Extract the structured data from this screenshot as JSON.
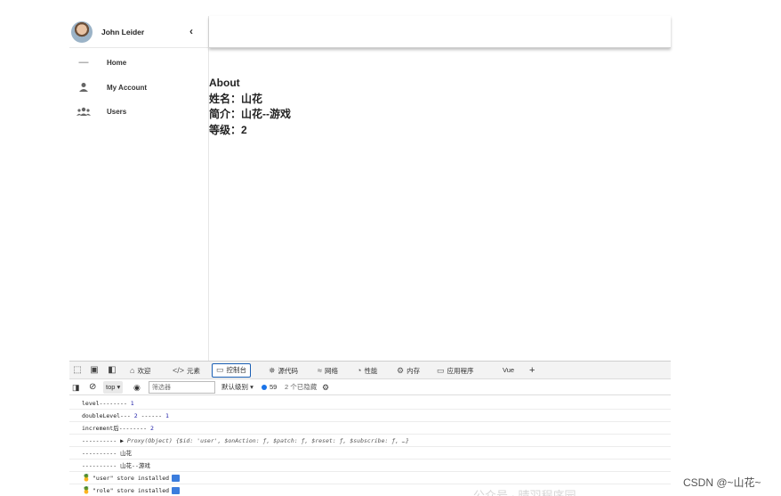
{
  "sidebar": {
    "user_name": "John Leider",
    "items": [
      {
        "label": "Home",
        "icon": "minus-icon"
      },
      {
        "label": "My Account",
        "icon": "person-icon"
      },
      {
        "label": "Users",
        "icon": "group-icon"
      }
    ]
  },
  "main": {
    "heading": "About",
    "lines": [
      "姓名：山花",
      "简介：山花--游戏",
      "等级：2"
    ]
  },
  "devtools": {
    "tabs": [
      {
        "label": "欢迎",
        "icon": "home-icon"
      },
      {
        "label": "元素",
        "icon": "code-icon"
      },
      {
        "label": "控制台",
        "icon": "console-icon"
      },
      {
        "label": "源代码",
        "icon": "bug-icon"
      },
      {
        "label": "网络",
        "icon": "wifi-icon"
      },
      {
        "label": "性能",
        "icon": "gauge-icon"
      },
      {
        "label": "内存",
        "icon": "memory-icon"
      },
      {
        "label": "应用程序",
        "icon": "application-icon"
      },
      {
        "label": "Vue",
        "icon": ""
      }
    ],
    "toolbar": {
      "context": "top",
      "filter_placeholder": "筛选器",
      "level": "默认级别",
      "message_count": "59",
      "hidden": "2 个已隐藏"
    },
    "console": [
      {
        "text": "level--------",
        "value": "1"
      },
      {
        "text": "doubleLevel---",
        "value": "2",
        "text2": "------",
        "value2": "1"
      },
      {
        "text": "increment后--------",
        "value": "2"
      },
      {
        "text": "----------",
        "object": "Proxy(Object) {$id: 'user', $onAction: ƒ, $patch: ƒ, $reset: ƒ, $subscribe: ƒ, …}"
      },
      {
        "text": "---------- 山花"
      },
      {
        "text": "---------- 山花--游戏"
      },
      {
        "text": "\"user\" store installed"
      },
      {
        "text": "\"role\" store installed"
      }
    ]
  },
  "watermark": "CSDN @~山花~",
  "faded_watermark": "公众号 · 晴羽程序园",
  "colors": {
    "accent": "#1a5fb4",
    "link_number": "#1a1aa6"
  }
}
